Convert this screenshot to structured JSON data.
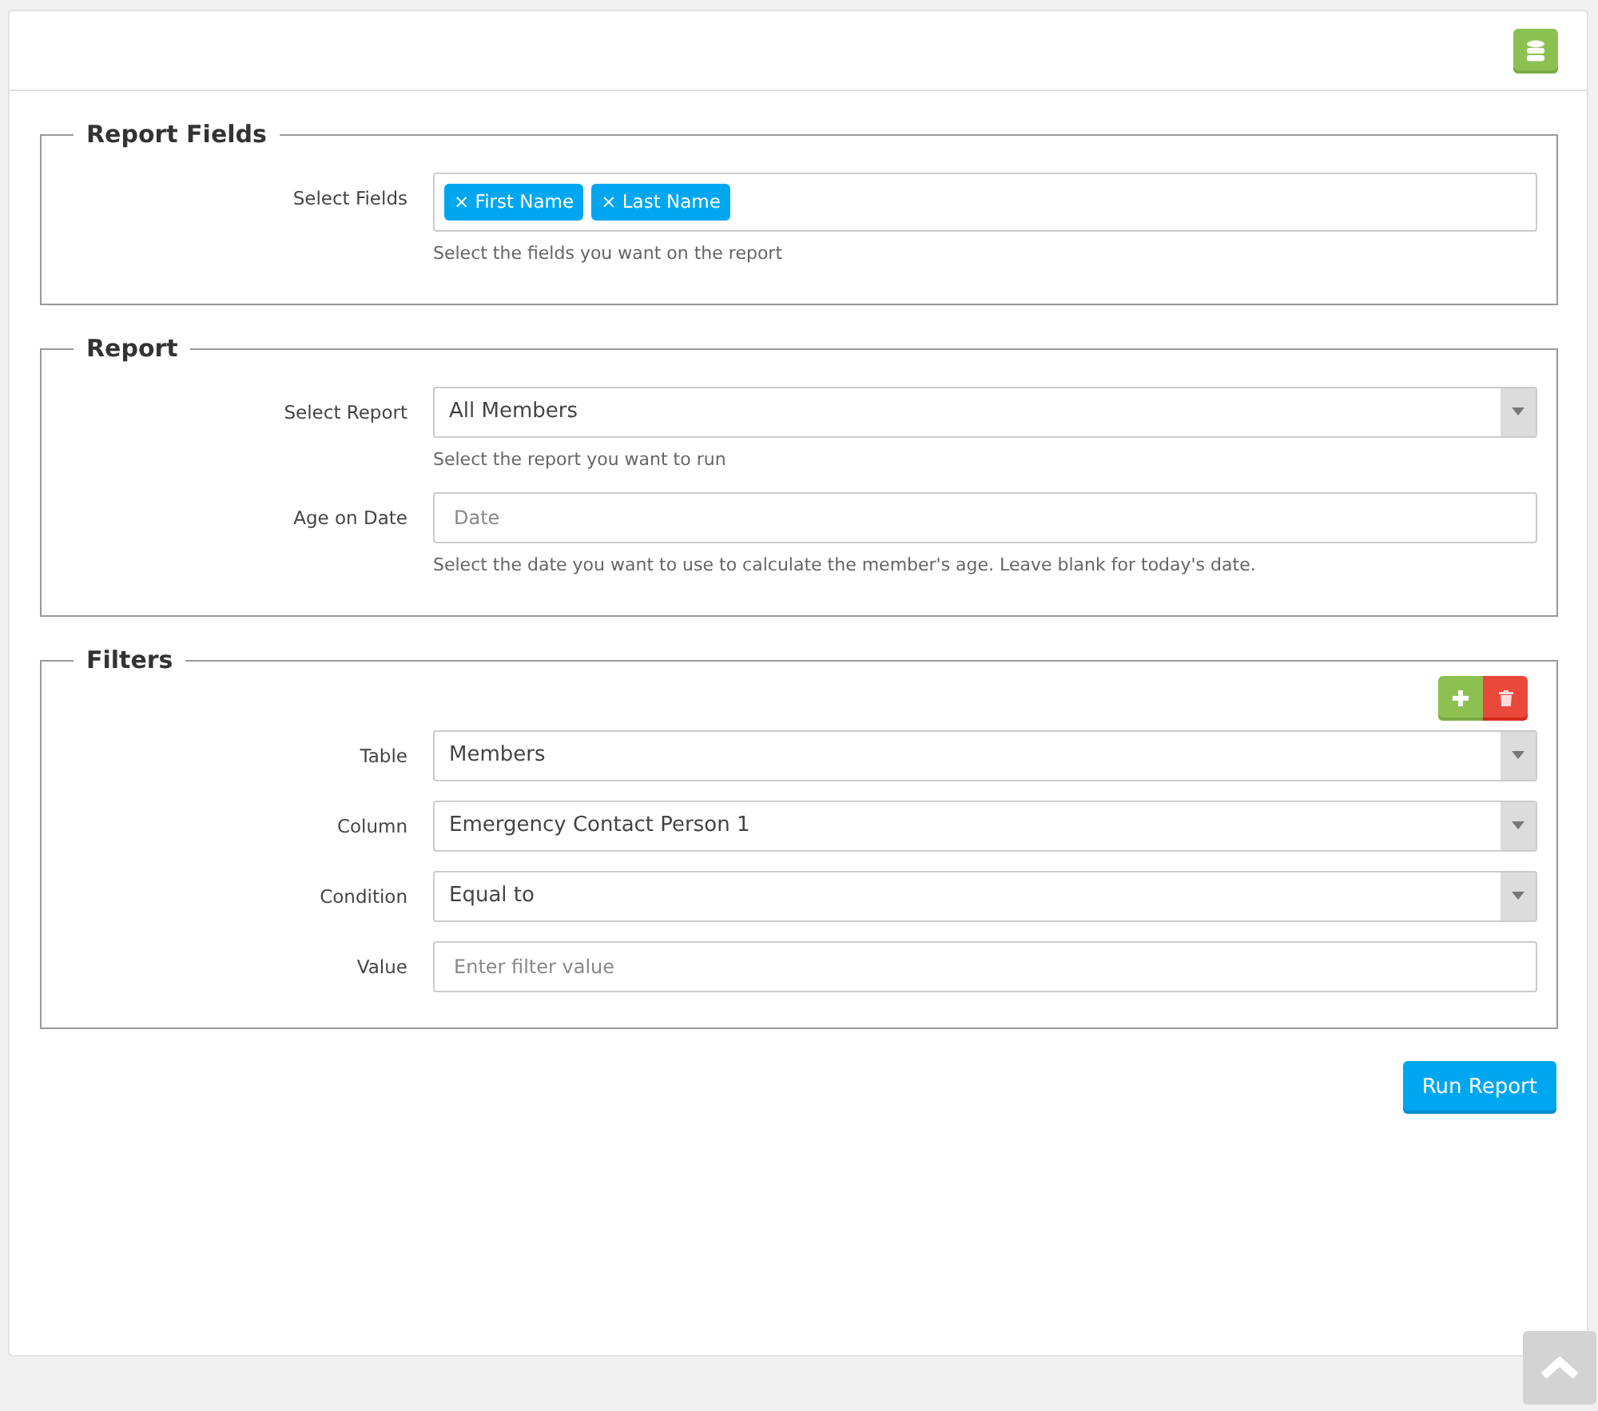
{
  "sections": [
    {
      "title": "Report Fields",
      "actions": false,
      "fields": [
        {
          "kind": "tags",
          "label": "Select Fields",
          "tags": [
            "First Name",
            "Last Name"
          ],
          "help": "Select the fields you want on the report"
        }
      ]
    },
    {
      "title": "Report",
      "actions": false,
      "fields": [
        {
          "kind": "select",
          "label": "Select Report",
          "value": "All Members",
          "help": "Select the report you want to run"
        },
        {
          "kind": "input",
          "label": "Age on Date",
          "placeholder": "Date",
          "help": "Select the date you want to use to calculate the member's age. Leave blank for today's date."
        }
      ]
    },
    {
      "title": "Filters",
      "actions": true,
      "fields": [
        {
          "kind": "select",
          "label": "Table",
          "value": "Members"
        },
        {
          "kind": "select",
          "label": "Column",
          "value": "Emergency Contact Person 1"
        },
        {
          "kind": "select",
          "label": "Condition",
          "value": "Equal to"
        },
        {
          "kind": "input",
          "label": "Value",
          "placeholder": "Enter filter value"
        }
      ]
    }
  ],
  "tag_remove": "×",
  "run_button": "Run Report"
}
